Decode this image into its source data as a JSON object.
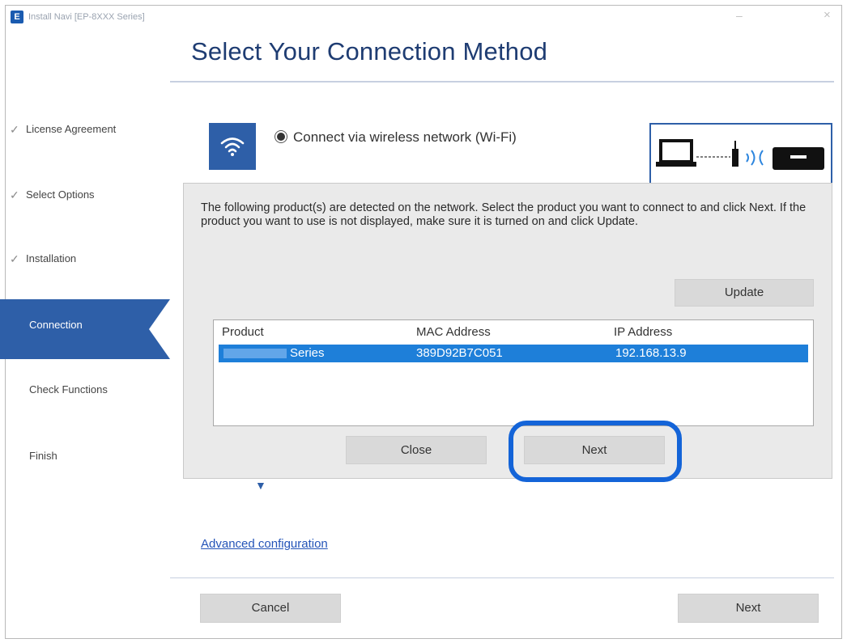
{
  "window": {
    "title": "Install Navi [EP-8XXX Series]",
    "minimize_glyph": "–",
    "close_glyph": "×"
  },
  "page": {
    "title": "Select Your Connection Method"
  },
  "steps": [
    {
      "label": "License Agreement",
      "state": "done"
    },
    {
      "label": "Select Options",
      "state": "done"
    },
    {
      "label": "Installation",
      "state": "done"
    },
    {
      "label": "Connection",
      "state": "active"
    },
    {
      "label": "Check Functions",
      "state": "pending"
    },
    {
      "label": "Finish",
      "state": "pending"
    }
  ],
  "connection": {
    "option_label": "Connect via wireless network (Wi-Fi)",
    "icon": "wifi-icon"
  },
  "dialog": {
    "message": "The following product(s) are detected on the network. Select the product you want to connect to and click Next. If the product you want to use is not displayed, make sure it is turned on and click Update.",
    "update_label": "Update",
    "close_label": "Close",
    "next_label": "Next",
    "table": {
      "columns": [
        "Product",
        "MAC Address",
        "IP Address"
      ],
      "rows": [
        {
          "product": "Series",
          "mac": "389D92B7C051",
          "ip": "192.168.13.9",
          "selected": true
        }
      ]
    }
  },
  "footer": {
    "advanced_link": "Advanced configuration",
    "cancel_label": "Cancel",
    "next_label": "Next"
  },
  "colors": {
    "accent": "#2e5fa8",
    "selection": "#1e7fd9",
    "highlight_ring": "#1464d8",
    "title": "#1e3c72"
  }
}
